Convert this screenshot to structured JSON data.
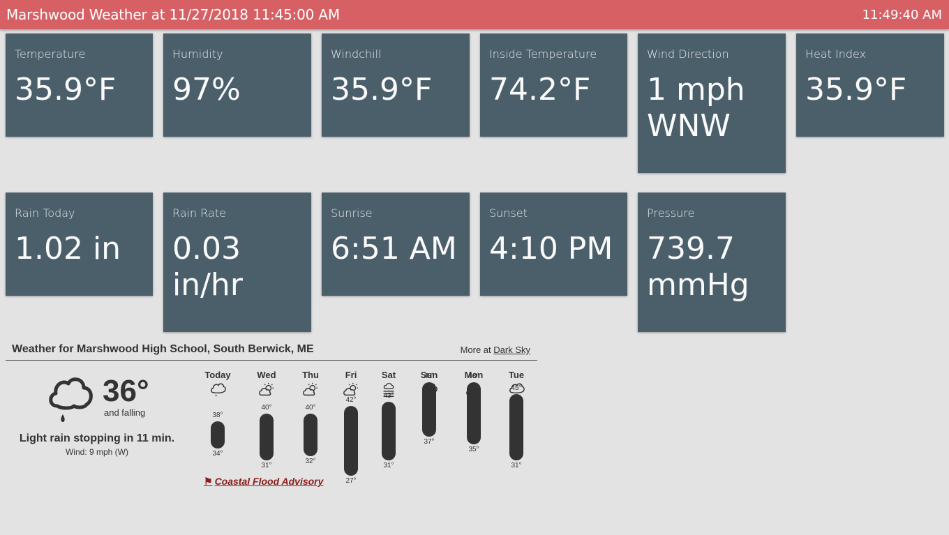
{
  "header": {
    "title": "Marshwood Weather at 11/27/2018 11:45:00 AM",
    "clock": "11:49:40 AM"
  },
  "tiles": [
    {
      "label": "Temperature",
      "value": "35.9°F"
    },
    {
      "label": "Humidity",
      "value": "97%"
    },
    {
      "label": "Windchill",
      "value": "35.9°F"
    },
    {
      "label": "Inside Temperature",
      "value": "74.2°F"
    },
    {
      "label": "Wind Direction",
      "value": "1 mph WNW"
    },
    {
      "label": "Heat Index",
      "value": "35.9°F"
    },
    {
      "label": "Rain Today",
      "value": "1.02 in"
    },
    {
      "label": "Rain Rate",
      "value": "0.03 in/hr"
    },
    {
      "label": "Sunrise",
      "value": "6:51 AM"
    },
    {
      "label": "Sunset",
      "value": "4:10 PM"
    },
    {
      "label": "Pressure",
      "value": "739.7 mmHg"
    }
  ],
  "forecast": {
    "title": "Weather for Marshwood High School, South Berwick, ME",
    "more_prefix": "More at",
    "more_link": "Dark Sky",
    "current": {
      "icon": "rain-cloud-icon",
      "temp": "36°",
      "trend": "and falling",
      "summary": "Light rain stopping in 11 min.",
      "wind": "Wind: 9 mph (W)"
    },
    "days": [
      {
        "name": "Today",
        "icon": "rain-cloud-icon",
        "high": "38°",
        "low": "34°"
      },
      {
        "name": "Wed",
        "icon": "partly-cloudy-icon",
        "high": "40°",
        "low": "31°"
      },
      {
        "name": "Thu",
        "icon": "partly-cloudy-icon",
        "high": "40°",
        "low": "32°"
      },
      {
        "name": "Fri",
        "icon": "partly-cloudy-icon",
        "high": "42°",
        "low": "27°"
      },
      {
        "name": "Sat",
        "icon": "fog-icon",
        "high": "43°",
        "low": "31°"
      },
      {
        "name": "Sun",
        "icon": "rain-cloud-icon",
        "high": "48°",
        "low": "37°"
      },
      {
        "name": "Mon",
        "icon": "partly-cloudy-night-icon",
        "high": "48°",
        "low": "35°"
      },
      {
        "name": "Tue",
        "icon": "rain-cloud-icon",
        "high": "45°",
        "low": "31°"
      }
    ],
    "advisory": "Coastal Flood Advisory"
  }
}
